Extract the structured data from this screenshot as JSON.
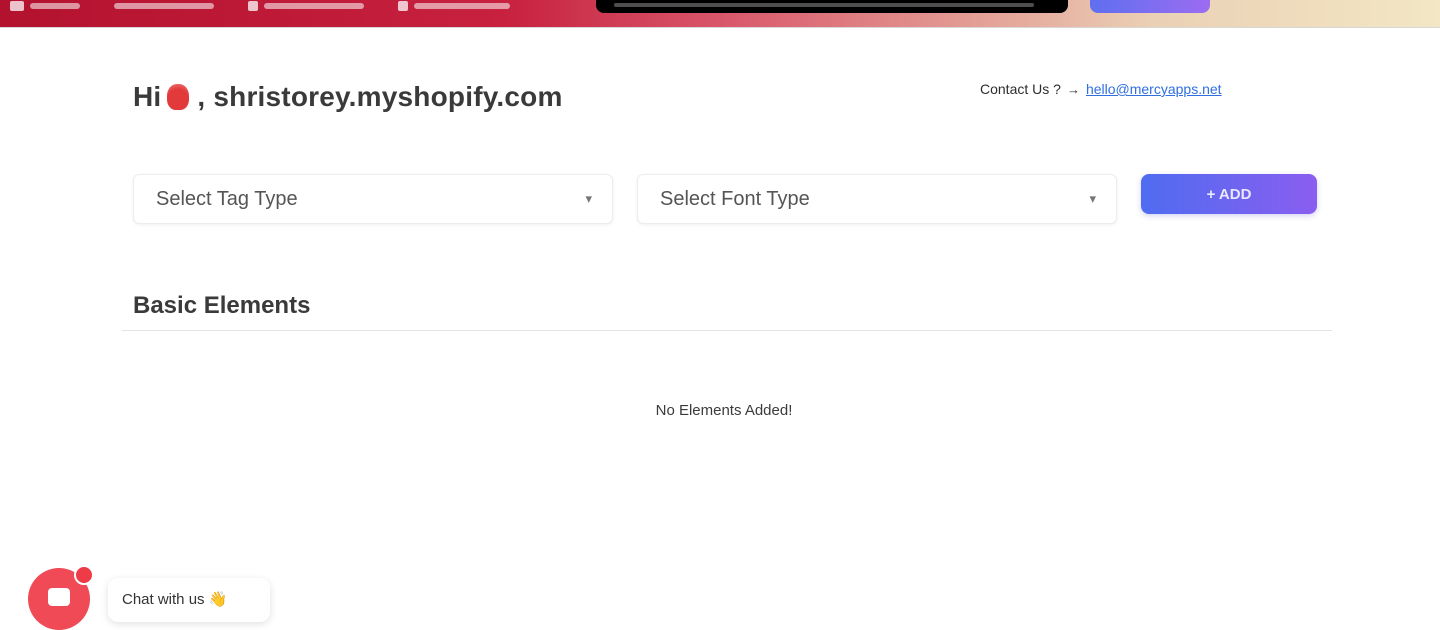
{
  "topbar": {
    "nav_items": [
      {
        "icon": "store-icon"
      },
      {
        "icon": "download-icon"
      },
      {
        "icon": "settings-icon"
      },
      {
        "icon": "help-icon"
      }
    ],
    "accent": "#c7213f"
  },
  "header": {
    "greeting_prefix": "Hi",
    "greeting_shop": ", shristorey.myshopify.com",
    "contact_label": "Contact Us ?",
    "contact_arrow": "→",
    "contact_email": "hello@mercyapps.net"
  },
  "form": {
    "tag_select_value": "Select Tag Type",
    "font_select_value": "Select Font Type",
    "add_button_label": "+ ADD"
  },
  "section": {
    "title": "Basic Elements",
    "empty_text": "No Elements Added!"
  },
  "chat": {
    "greeting": "Chat with us 👋"
  }
}
